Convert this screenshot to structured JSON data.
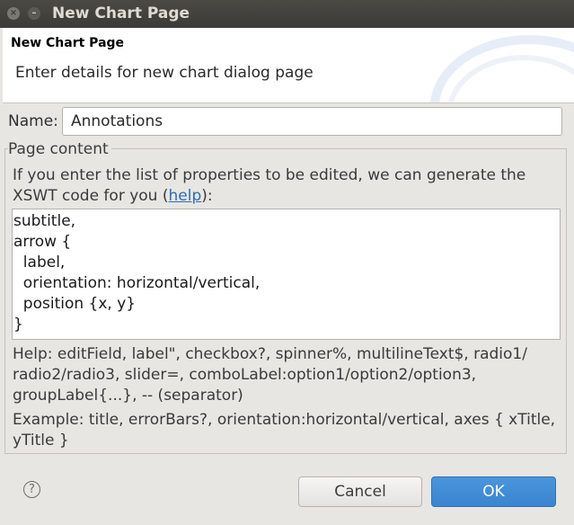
{
  "window": {
    "title": "New Chart Page",
    "close_glyph": "×",
    "minimize_glyph": "–"
  },
  "header": {
    "title": "New Chart Page",
    "description": "Enter details for new chart dialog page"
  },
  "name_field": {
    "label": "Name:",
    "value": "Annotations"
  },
  "page_content": {
    "legend": "Page content",
    "intro_prefix": "If you enter the list of properties to be edited, we can generate the XSWT code for you (",
    "help_link": "help",
    "intro_suffix": "):",
    "properties_text": "subtitle,\narrow {\n  label,\n  orientation: horizontal/vertical,\n  position {x, y}\n}",
    "help_text": "Help: editField, label\", checkbox?, spinner%, multilineText$, radio1/ radio2/radio3, slider=, comboLabel:option1/option2/option3, groupLabel{...}, -- (separator)",
    "example_text": "Example: title, errorBars?, orientation:horizontal/vertical, axes { xTitle, yTitle }"
  },
  "footer": {
    "help_glyph": "?",
    "cancel_label": "Cancel",
    "ok_label": "OK"
  },
  "colors": {
    "titlebar": "#3c3b37",
    "ok_button": "#3b85cf",
    "link": "#2d6db7"
  }
}
